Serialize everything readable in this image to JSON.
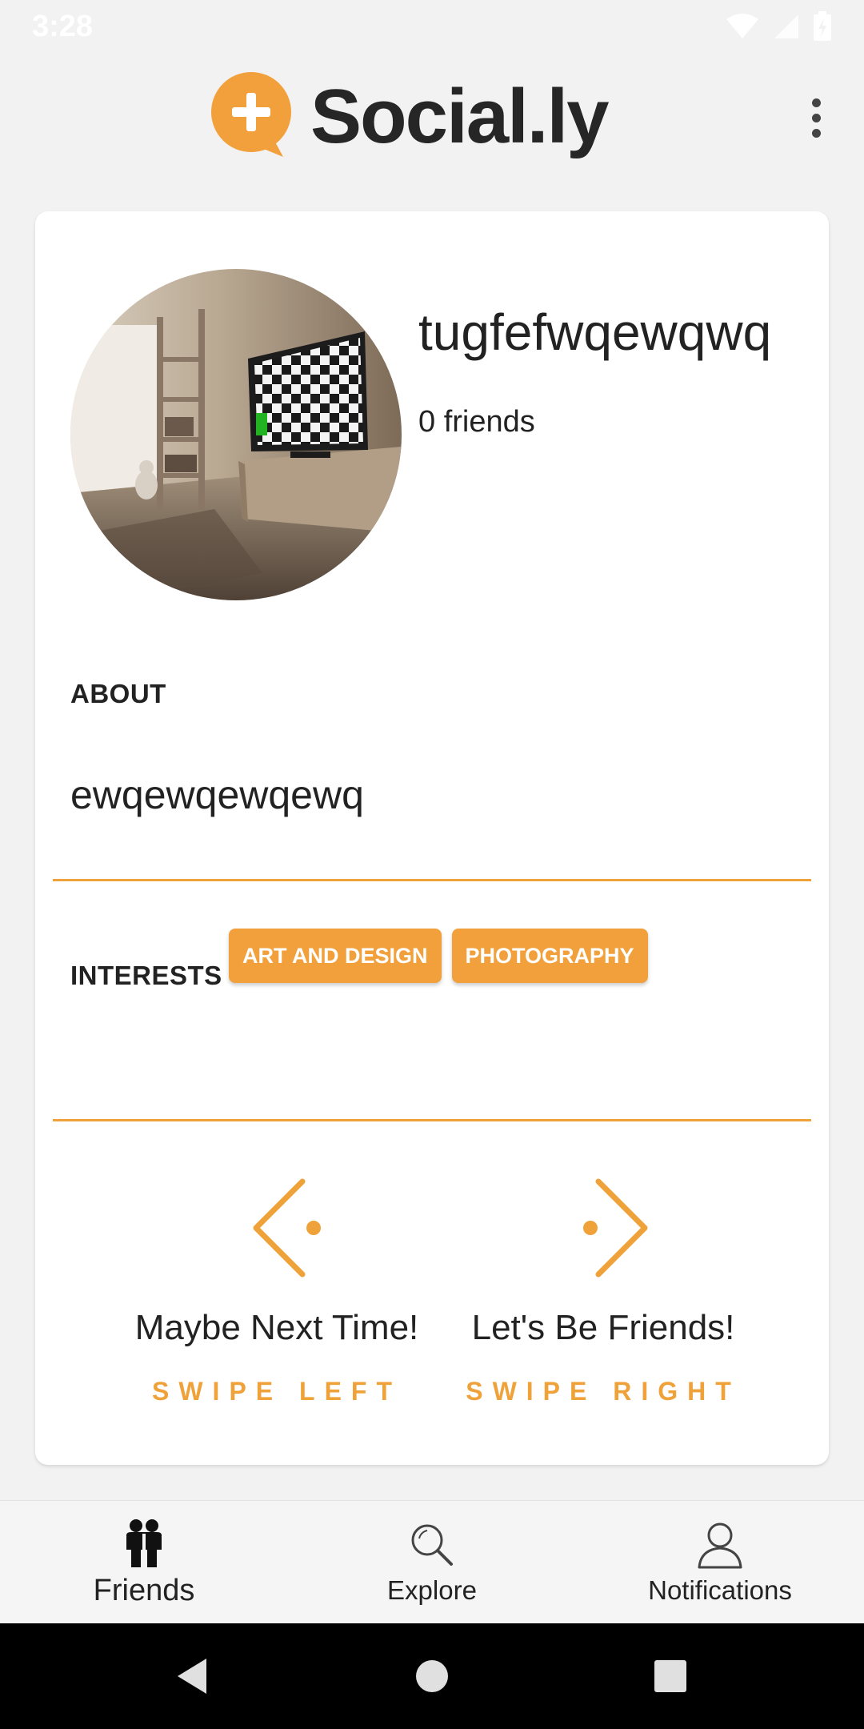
{
  "status_bar": {
    "time": "3:28"
  },
  "app_bar": {
    "title": "Social.ly"
  },
  "profile": {
    "username": "tugfefwqewqwq",
    "friends_count": "0 friends",
    "about_label": "ABOUT",
    "about_text": "ewqewqewqewq",
    "interests_label": "INTERESTS",
    "interests": [
      "ART AND DESIGN",
      "PHOTOGRAPHY"
    ]
  },
  "swipe": {
    "left": {
      "title": "Maybe Next Time!",
      "hint": "SWIPE LEFT"
    },
    "right": {
      "title": "Let's Be Friends!",
      "hint": "SWIPE RIGHT"
    }
  },
  "bottom_nav": {
    "items": [
      {
        "label": "Friends",
        "icon": "friends-icon",
        "active": true
      },
      {
        "label": "Explore",
        "icon": "search-icon",
        "active": false
      },
      {
        "label": "Notifications",
        "icon": "person-icon",
        "active": false
      }
    ]
  },
  "colors": {
    "accent": "#f0a23a",
    "background": "#f2f2f2",
    "card": "#ffffff"
  }
}
